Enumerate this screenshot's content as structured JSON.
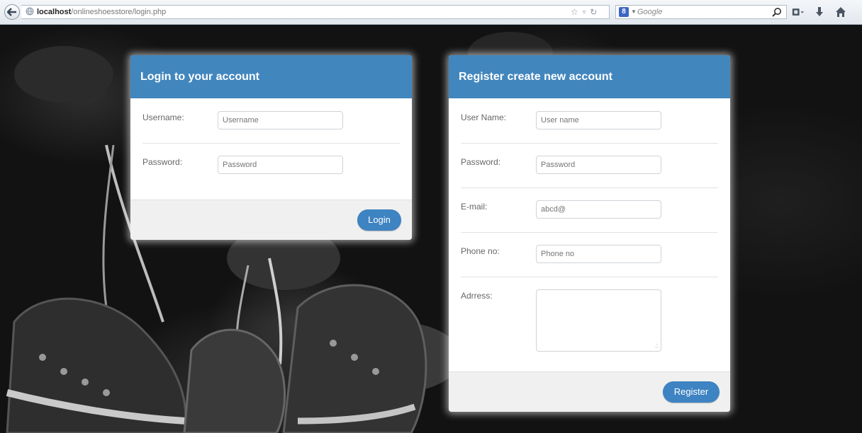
{
  "browser": {
    "url_host": "localhost",
    "url_path": "/onlineshoesstore/login.php",
    "search_engine_badge": "8",
    "search_placeholder": "Google",
    "url_controls": "☆ ▿ C"
  },
  "login": {
    "title": "Login to your account",
    "username_label": "Username:",
    "username_placeholder": "Username",
    "password_label": "Password:",
    "password_placeholder": "Password",
    "button": "Login"
  },
  "register": {
    "title": "Register create new account",
    "username_label": "User Name:",
    "username_placeholder": "User name",
    "password_label": "Password:",
    "password_placeholder": "Password",
    "email_label": "E-mail:",
    "email_placeholder": "abcd@",
    "phone_label": "Phone no:",
    "phone_placeholder": "Phone no",
    "address_label": "Adrress:",
    "button": "Register"
  },
  "colors": {
    "panel_header": "#4286be",
    "button": "#3e83c2",
    "background": "#121212"
  },
  "icons": [
    "back-arrow-icon",
    "globe-icon",
    "bookmark-star-icon",
    "reload-icon",
    "google-engine-icon",
    "search-magnifier-icon",
    "bookmarks-menu-icon",
    "download-icon",
    "home-icon"
  ]
}
